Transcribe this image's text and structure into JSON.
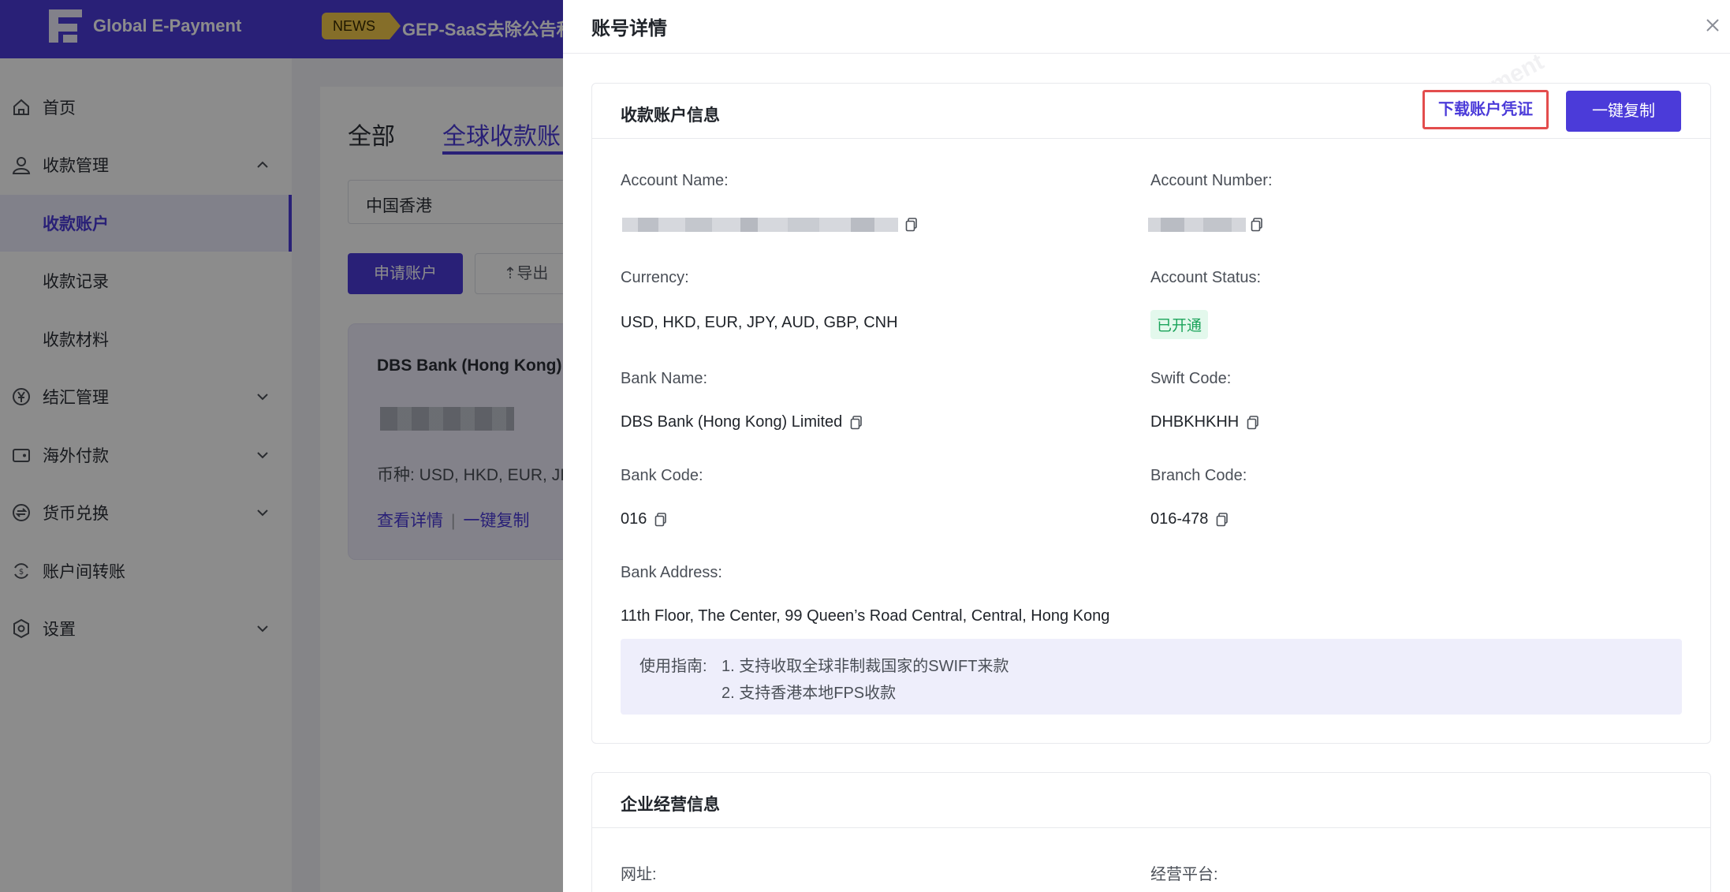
{
  "app": {
    "brand": "Global E-Payment",
    "news_badge": "NEWS",
    "news_text": "GEP-SaaS去除公告和"
  },
  "sidebar": {
    "items": [
      {
        "label": "首页",
        "icon": "home-icon"
      },
      {
        "label": "收款管理",
        "icon": "user-icon",
        "expanded": true
      },
      {
        "label": "收款账户",
        "active": true
      },
      {
        "label": "收款记录"
      },
      {
        "label": "收款材料"
      },
      {
        "label": "结汇管理",
        "icon": "yen-circle-icon"
      },
      {
        "label": "海外付款",
        "icon": "wallet-icon"
      },
      {
        "label": "货币兑换",
        "icon": "exchange-icon"
      },
      {
        "label": "账户间转账",
        "icon": "transfer-icon"
      },
      {
        "label": "设置",
        "icon": "settings-icon"
      }
    ]
  },
  "main": {
    "tabs": [
      {
        "label": "全部"
      },
      {
        "label": "全球收款账"
      }
    ],
    "region_select": "中国香港",
    "apply_button": "申请账户",
    "export_button": "⇡导出",
    "bank_card": {
      "title": "DBS Bank (Hong Kong) l",
      "currency": "币种: USD, HKD, EUR, JI",
      "view_details": "查看详情",
      "copy_all": "一键复制"
    }
  },
  "drawer": {
    "title": "账号详情",
    "section_account": {
      "title": "收款账户信息",
      "download_button": "下载账户凭证",
      "copy_all_button": "一键复制",
      "account_name_label": "Account Name:",
      "account_number_label": "Account Number:",
      "currency_label": "Currency:",
      "currency_value": "USD, HKD, EUR, JPY, AUD, GBP, CNH",
      "account_status_label": "Account Status:",
      "account_status_value": "已开通",
      "bank_name_label": "Bank Name:",
      "bank_name_value": "DBS Bank (Hong Kong) Limited",
      "swift_code_label": "Swift Code:",
      "swift_code_value": "DHBKHKHH",
      "bank_code_label": "Bank Code:",
      "bank_code_value": "016",
      "branch_code_label": "Branch Code:",
      "branch_code_value": "016-478",
      "bank_address_label": "Bank Address:",
      "bank_address_value": "11th Floor, The Center, 99 Queen’s Road Central, Central, Hong Kong",
      "guide_label": "使用指南:",
      "guide_line1": "1. 支持收取全球非制裁国家的SWIFT来款",
      "guide_line2": "2. 支持香港本地FPS收款"
    },
    "section_business": {
      "title": "企业经营信息",
      "website_label": "网址:",
      "platform_label": "经营平台:"
    }
  },
  "colors": {
    "primary": "#4b3bd9",
    "highlight_border": "#e34d4d",
    "status_green": "#1aa35a"
  }
}
